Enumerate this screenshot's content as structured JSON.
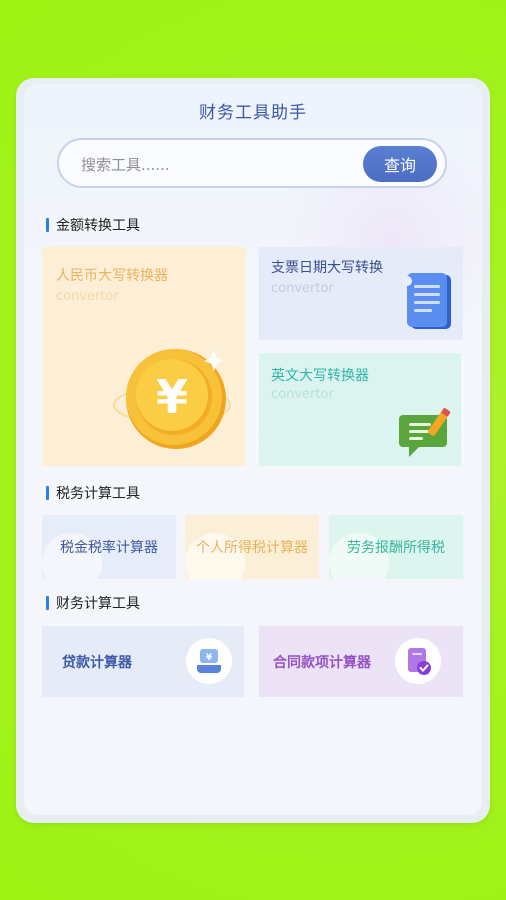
{
  "header": {
    "title": "财务工具助手"
  },
  "search": {
    "placeholder": "搜索工具......",
    "button_label": "查询"
  },
  "sections": {
    "amount": {
      "title": "金额转换工具",
      "tiles": [
        {
          "title": "人民币大写转换器",
          "subtitle": "convertor",
          "icon": "yuan-coin-icon"
        },
        {
          "title": "支票日期大写转换",
          "subtitle": "convertor",
          "icon": "document-icon"
        },
        {
          "title": "英文大写转换器",
          "subtitle": "convertor",
          "icon": "chat-pencil-icon"
        }
      ]
    },
    "tax": {
      "title": "税务计算工具",
      "tiles": [
        {
          "title": "税金税率计算器"
        },
        {
          "title": "个人所得税计算器"
        },
        {
          "title": "劳务报酬所得税"
        }
      ]
    },
    "finance": {
      "title": "财务计算工具",
      "tiles": [
        {
          "title": "贷款计算器",
          "icon": "loan-icon"
        },
        {
          "title": "合同款项计算器",
          "icon": "contract-icon"
        }
      ]
    }
  },
  "colors": {
    "background": "#9df213",
    "accent": "#4c6dc4"
  }
}
